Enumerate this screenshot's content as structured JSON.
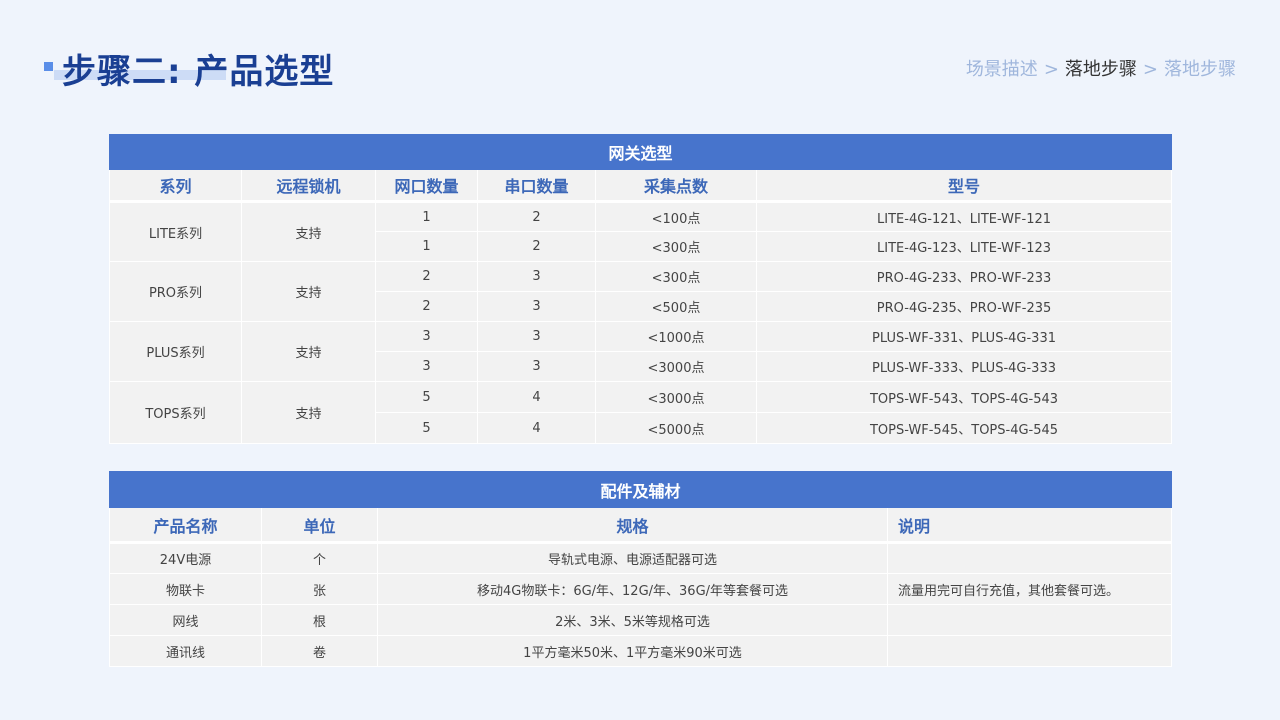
{
  "header": {
    "title": "步骤二: 产品选型",
    "breadcrumb": [
      "场景描述",
      "落地步骤",
      "落地步骤"
    ],
    "breadcrumb_sep": ">"
  },
  "gateway_table": {
    "caption": "网关选型",
    "headers": [
      "系列",
      "远程锁机",
      "网口数量",
      "串口数量",
      "采集点数",
      "型号"
    ],
    "groups": [
      {
        "series": "LITE系列",
        "lock": "支持",
        "rows": [
          {
            "ports": "1",
            "serial": "2",
            "points": "<100点",
            "model": "LITE-4G-121、LITE-WF-121"
          },
          {
            "ports": "1",
            "serial": "2",
            "points": "<300点",
            "model": "LITE-4G-123、LITE-WF-123"
          }
        ]
      },
      {
        "series": "PRO系列",
        "lock": "支持",
        "rows": [
          {
            "ports": "2",
            "serial": "3",
            "points": "<300点",
            "model": "PRO-4G-233、PRO-WF-233"
          },
          {
            "ports": "2",
            "serial": "3",
            "points": "<500点",
            "model": "PRO-4G-235、PRO-WF-235"
          }
        ]
      },
      {
        "series": "PLUS系列",
        "lock": "支持",
        "rows": [
          {
            "ports": "3",
            "serial": "3",
            "points": "<1000点",
            "model": "PLUS-WF-331、PLUS-4G-331"
          },
          {
            "ports": "3",
            "serial": "3",
            "points": "<3000点",
            "model": "PLUS-WF-333、PLUS-4G-333"
          }
        ]
      },
      {
        "series": "TOPS系列",
        "lock": "支持",
        "rows": [
          {
            "ports": "5",
            "serial": "4",
            "points": "<3000点",
            "model": "TOPS-WF-543、TOPS-4G-543"
          },
          {
            "ports": "5",
            "serial": "4",
            "points": "<5000点",
            "model": "TOPS-WF-545、TOPS-4G-545"
          }
        ]
      }
    ]
  },
  "accessory_table": {
    "caption": "配件及辅材",
    "headers": [
      "产品名称",
      "单位",
      "规格",
      "说明"
    ],
    "rows": [
      {
        "name": "24V电源",
        "unit": "个",
        "spec": "导轨式电源、电源适配器可选",
        "note": ""
      },
      {
        "name": "物联卡",
        "unit": "张",
        "spec": "移动4G物联卡：6G/年、12G/年、36G/年等套餐可选",
        "note": "流量用完可自行充值，其他套餐可选。"
      },
      {
        "name": "网线",
        "unit": "根",
        "spec": "2米、3米、5米等规格可选",
        "note": ""
      },
      {
        "name": "通讯线",
        "unit": "卷",
        "spec": "1平方毫米50米、1平方毫米90米可选",
        "note": ""
      }
    ]
  },
  "colors": {
    "background": "#eff4fc",
    "title": "#1a3f93",
    "table_caption_bg": "#4774cc",
    "table_header_text": "#3d68b8",
    "cell_bg": "#f2f2f2"
  }
}
